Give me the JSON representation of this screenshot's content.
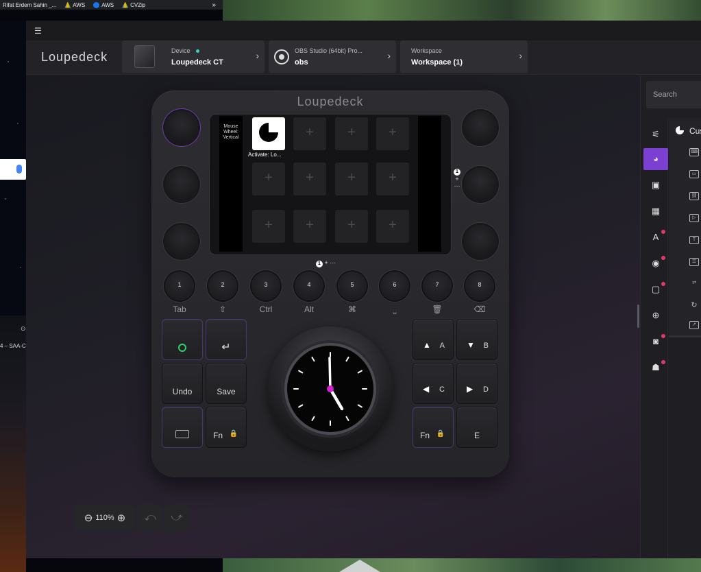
{
  "browser": {
    "bookmarks": [
      {
        "label": "Rifat Erdem Sahin _...",
        "icon": "none"
      },
      {
        "label": "AWS",
        "icon": "drive-icon"
      },
      {
        "label": "AWS",
        "icon": "circle-icon"
      },
      {
        "label": "CVZip",
        "icon": "drive-icon"
      }
    ],
    "more": "»",
    "side_text": "4 – SAA-C",
    "side_clock": "⊙"
  },
  "app": {
    "menu_icon": "☰",
    "logo": "Loupedeck",
    "device": {
      "label": "Device",
      "name": "Loupedeck CT",
      "status_color": "#3bd1c2"
    },
    "profile": {
      "label": "OBS Studio (64bit) Pro...",
      "name": "obs"
    },
    "workspace": {
      "label": "Workspace",
      "name": "Workspace (1)"
    },
    "chevron": "›"
  },
  "device_ui": {
    "logo": "Loupedeck",
    "left_panel_text": "Mouse Wheel: Vertical",
    "tile_caption": "Activate: Lo...",
    "tile_plus": "+",
    "page_indicator": {
      "num": "1",
      "plus": "+",
      "more": "···"
    },
    "round_buttons": [
      "1",
      "2",
      "3",
      "4",
      "5",
      "6",
      "7",
      "8"
    ],
    "round_labels": [
      "Tab",
      "⇧",
      "Ctrl",
      "Alt",
      "⌘",
      "⎵",
      "🗑",
      "⌫"
    ],
    "left_keys": {
      "undo": "Undo",
      "save": "Save",
      "fn": "Fn",
      "return_glyph": "↵"
    },
    "right_keys": {
      "a": "A",
      "b": "B",
      "c": "C",
      "d": "D",
      "e": "E",
      "fn": "Fn"
    },
    "accent": "#7b3fd1"
  },
  "toolbar": {
    "zoom": "110%",
    "zoom_out": "⊖",
    "zoom_in": "⊕",
    "undo": "⤺",
    "redo": "⤻"
  },
  "right_panel": {
    "search_placeholder": "Search",
    "plugin_title": "Cus",
    "accent": "#7b3fd1",
    "badge_color": "#e5386b"
  }
}
